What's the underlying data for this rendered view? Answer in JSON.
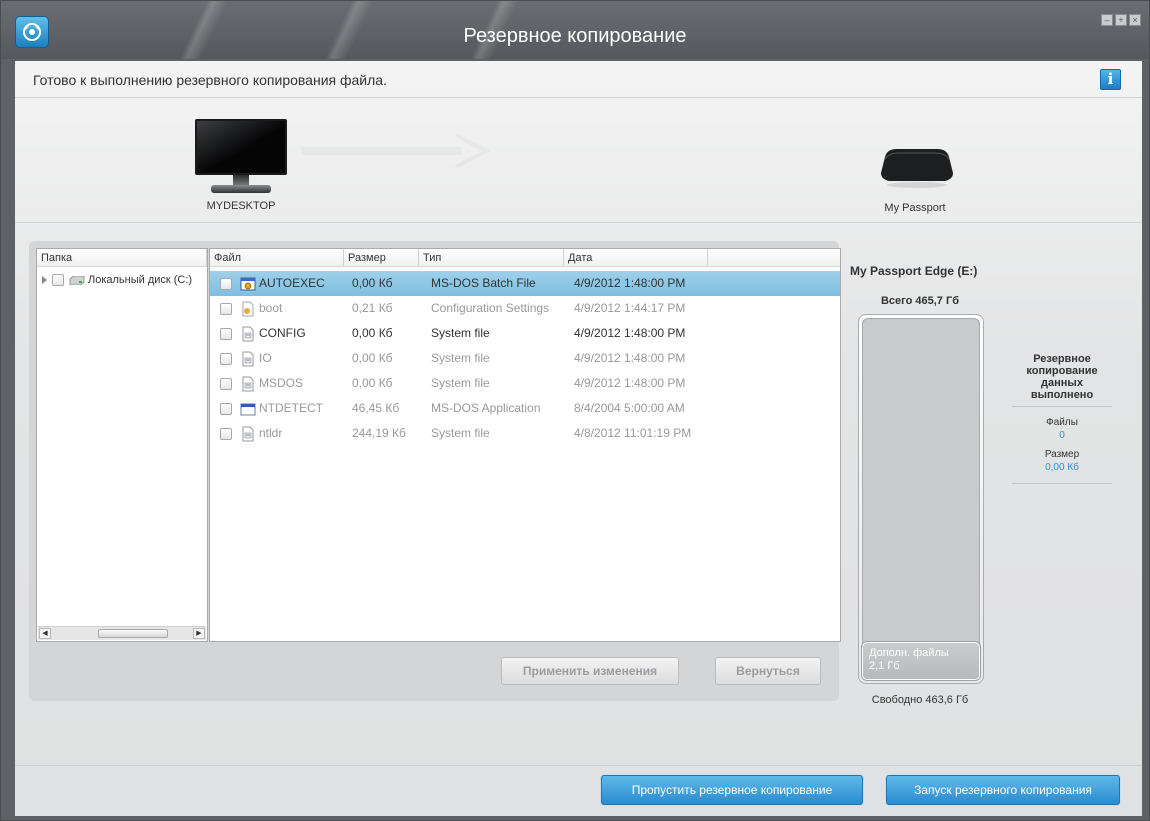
{
  "window": {
    "title": "Резервное копирование",
    "controls": [
      "minimize-icon",
      "maximize-icon",
      "close-icon"
    ]
  },
  "status": {
    "text": "Готово к выполнению резервного копирования файла.",
    "info_label": "i"
  },
  "devices": {
    "source_name": "MYDESKTOP",
    "target_name": "My Passport"
  },
  "folder_pane": {
    "header": "Папка",
    "items": [
      {
        "label": "Локальный диск (C:)",
        "icon": "hard-disk-icon"
      }
    ]
  },
  "file_pane": {
    "columns": [
      "Файл",
      "Размер",
      "Тип",
      "Дата"
    ],
    "rows": [
      {
        "name": "AUTOEXEC",
        "size": "0,00 Кб",
        "type": "MS-DOS Batch File",
        "date": "4/9/2012 1:48:00 PM",
        "icon": "batch-file-icon",
        "selected": true,
        "dim": false
      },
      {
        "name": "boot",
        "size": "0,21 Кб",
        "type": "Configuration Settings",
        "date": "4/9/2012 1:44:17 PM",
        "icon": "settings-file-icon",
        "selected": false,
        "dim": true
      },
      {
        "name": "CONFIG",
        "size": "0,00 Кб",
        "type": "System file",
        "date": "4/9/2012 1:48:00 PM",
        "icon": "system-file-icon",
        "selected": false,
        "dim": false
      },
      {
        "name": "IO",
        "size": "0,00 Кб",
        "type": "System file",
        "date": "4/9/2012 1:48:00 PM",
        "icon": "system-file-icon",
        "selected": false,
        "dim": true
      },
      {
        "name": "MSDOS",
        "size": "0,00 Кб",
        "type": "System file",
        "date": "4/9/2012 1:48:00 PM",
        "icon": "system-file-icon",
        "selected": false,
        "dim": true
      },
      {
        "name": "NTDETECT",
        "size": "46,45 Кб",
        "type": "MS-DOS Application",
        "date": "8/4/2004 5:00:00 AM",
        "icon": "application-icon",
        "selected": false,
        "dim": true
      },
      {
        "name": "ntldr",
        "size": "244,19 Кб",
        "type": "System file",
        "date": "4/8/2012 11:01:19 PM",
        "icon": "system-file-icon",
        "selected": false,
        "dim": true
      }
    ]
  },
  "buttons": {
    "apply": "Применить изменения",
    "revert": "Вернуться",
    "skip": "Пропустить резервное копирование",
    "start": "Запуск резервного копирования"
  },
  "capacity": {
    "drive_title": "My Passport Edge (E:)",
    "total": "Всего 465,7 Гб",
    "additional_label": "Дополн. файлы",
    "additional_value": "2,1 Гб",
    "additional_fraction": 0.0045,
    "free": "Свободно 463,6 Гб"
  },
  "summary": {
    "heading": "Резервное копирование данных выполнено",
    "files_label": "Файлы",
    "files_value": "0",
    "size_label": "Размер",
    "size_value": "0,00 Кб"
  },
  "colors": {
    "accent": "#2a8ccf",
    "selection": "#8cc7e5",
    "titlebar": "#5e6266"
  }
}
